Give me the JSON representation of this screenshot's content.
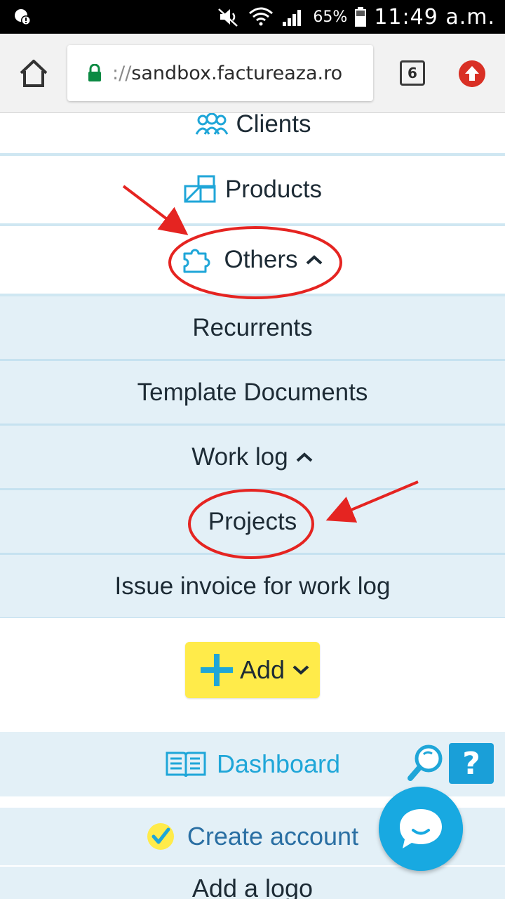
{
  "status_bar": {
    "battery_percent": "65%",
    "time": "11:49 a.m."
  },
  "browser": {
    "url_scheme": "://",
    "url_host": "sandbox.factureaza.ro",
    "tab_count": "6"
  },
  "menu": {
    "clients": "Clients",
    "products": "Products",
    "others": "Others",
    "submenu": {
      "recurrents": "Recurrents",
      "template_documents": "Template Documents",
      "work_log": "Work log",
      "projects": "Projects",
      "issue_invoice": "Issue invoice for work log"
    }
  },
  "add_button": {
    "label": "Add"
  },
  "bottom": {
    "dashboard": "Dashboard",
    "create_account": "Create account",
    "add_logo": "Add a logo",
    "help": "?"
  },
  "colors": {
    "accent": "#1fa6d8",
    "submenu_bg": "#e3f0f7",
    "add_button_bg": "#ffeb4a",
    "annotation_red": "#e52421",
    "chat_fab": "#18a9e1"
  }
}
